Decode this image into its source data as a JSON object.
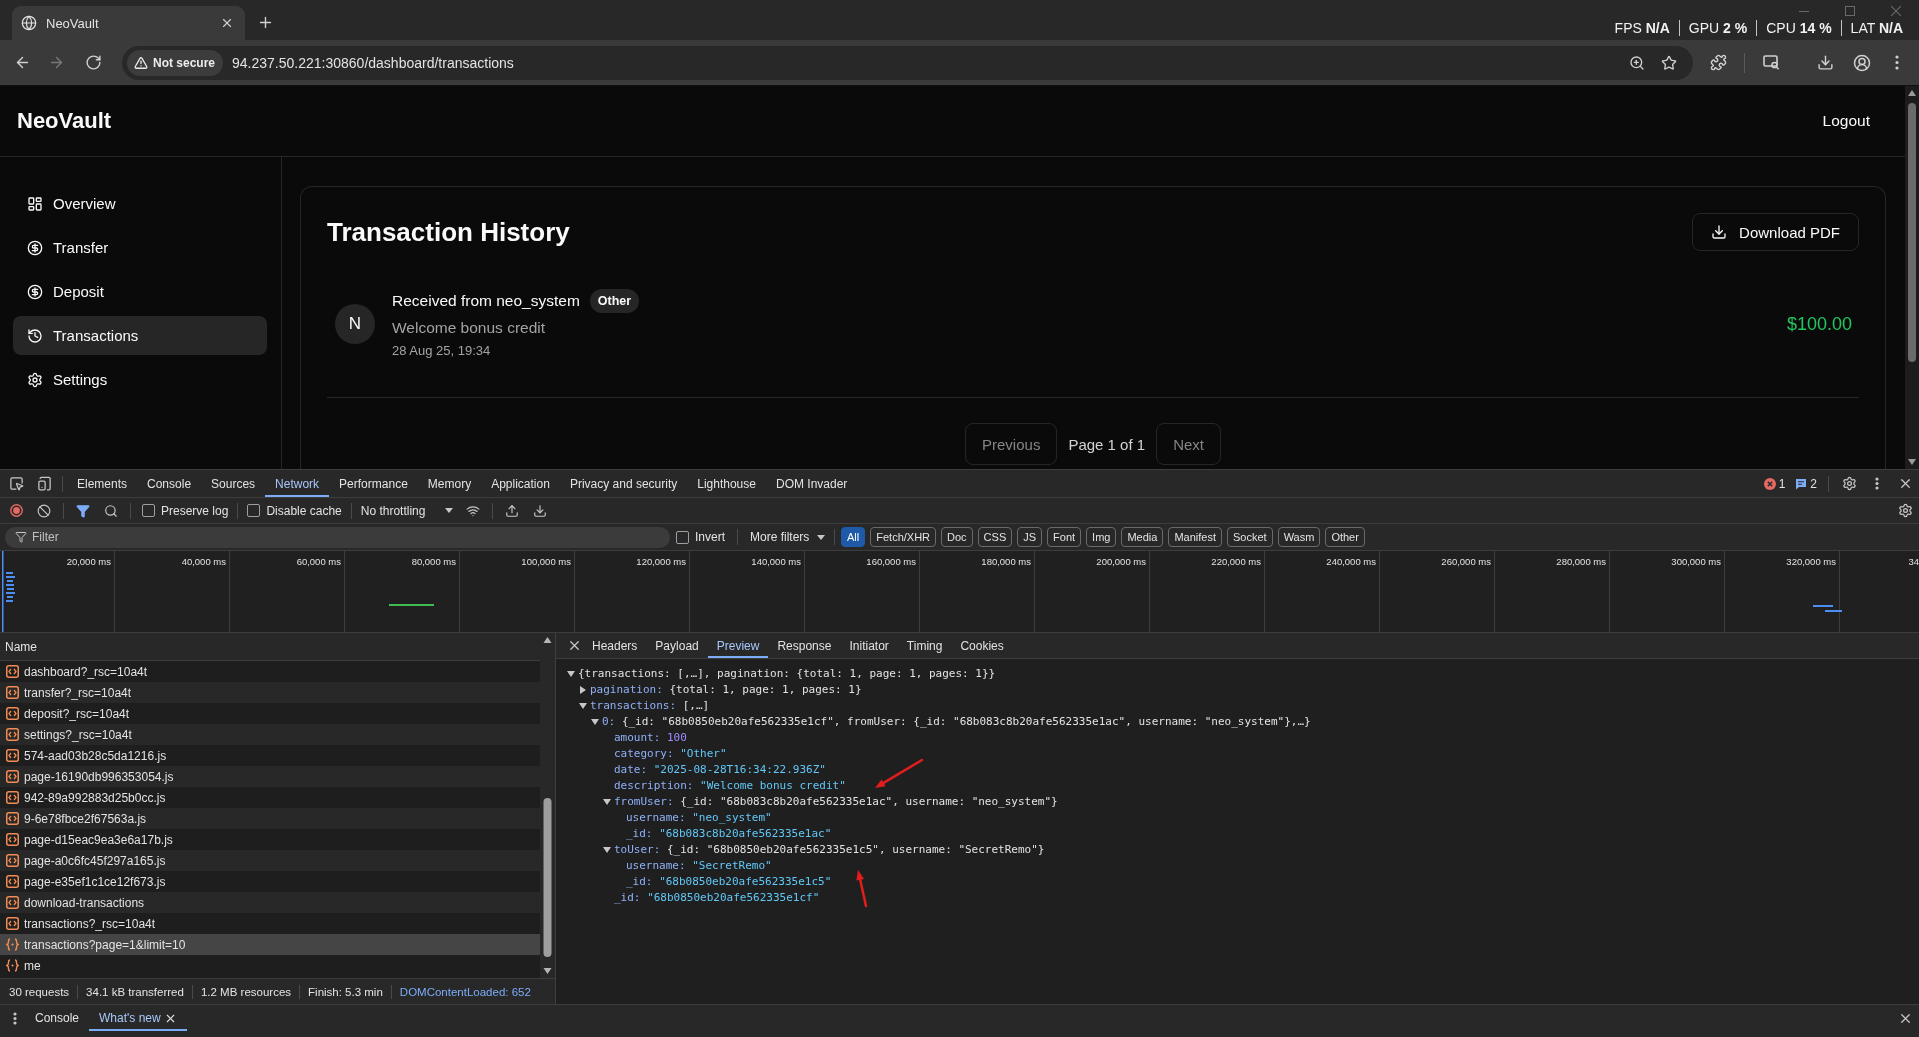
{
  "browser": {
    "tab": {
      "title": "NeoVault"
    },
    "perf_overlay": [
      {
        "label": "FPS",
        "value": "N/A"
      },
      {
        "label": "GPU",
        "value": "2 %"
      },
      {
        "label": "CPU",
        "value": "14 %"
      },
      {
        "label": "LAT",
        "value": "N/A"
      }
    ],
    "nav_buttons": [
      {
        "kind": "back",
        "disabled": false
      },
      {
        "kind": "forward",
        "disabled": true
      },
      {
        "kind": "reload",
        "disabled": false
      }
    ],
    "security_chip": "Not secure",
    "url": "94.237.50.221:30860/dashboard/transactions"
  },
  "app": {
    "brand": "NeoVault",
    "logout": "Logout",
    "nav": [
      {
        "label": "Overview",
        "kind": "grid",
        "selected": false
      },
      {
        "label": "Transfer",
        "kind": "dollar",
        "selected": false
      },
      {
        "label": "Deposit",
        "kind": "dollar",
        "selected": false
      },
      {
        "label": "Transactions",
        "kind": "history",
        "selected": true
      },
      {
        "label": "Settings",
        "kind": "gear",
        "selected": false
      }
    ],
    "title": "Transaction History",
    "download_button": "Download PDF",
    "transactions": [
      {
        "avatar": "N",
        "title": "Received from neo_system",
        "category": "Other",
        "description": "Welcome bonus credit",
        "date": "28 Aug 25, 19:34",
        "amount": "$100.00",
        "incoming": true
      }
    ],
    "pagination": {
      "previous": {
        "label": "Previous",
        "disabled": true
      },
      "status": "Page 1 of 1",
      "next": {
        "label": "Next",
        "disabled": true
      }
    }
  },
  "devtools": {
    "panel_tabs": [
      {
        "label": "Elements",
        "selected": false
      },
      {
        "label": "Console",
        "selected": false
      },
      {
        "label": "Sources",
        "selected": false
      },
      {
        "label": "Network",
        "selected": true
      },
      {
        "label": "Performance",
        "selected": false
      },
      {
        "label": "Memory",
        "selected": false
      },
      {
        "label": "Application",
        "selected": false
      },
      {
        "label": "Privacy and security",
        "selected": false
      },
      {
        "label": "Lighthouse",
        "selected": false
      },
      {
        "label": "DOM Invader",
        "selected": false
      }
    ],
    "issue_counts": [
      {
        "kind": "error",
        "count": "1"
      },
      {
        "kind": "message",
        "count": "2"
      }
    ],
    "network_toolbar": {
      "recording": true,
      "filter_active": true,
      "options": [
        {
          "label": "Preserve log",
          "checked": false
        },
        {
          "label": "Disable cache",
          "checked": false
        }
      ],
      "throttling": "No throttling"
    },
    "filter_bar": {
      "placeholder": "Filter",
      "invert": {
        "label": "Invert",
        "checked": false
      },
      "more_filters": "More filters",
      "types": [
        {
          "label": "All",
          "selected": true
        },
        {
          "label": "Fetch/XHR",
          "selected": false
        },
        {
          "label": "Doc",
          "selected": false
        },
        {
          "label": "CSS",
          "selected": false
        },
        {
          "label": "JS",
          "selected": false
        },
        {
          "label": "Font",
          "selected": false
        },
        {
          "label": "Img",
          "selected": false
        },
        {
          "label": "Media",
          "selected": false
        },
        {
          "label": "Manifest",
          "selected": false
        },
        {
          "label": "Socket",
          "selected": false
        },
        {
          "label": "Wasm",
          "selected": false
        },
        {
          "label": "Other",
          "selected": false
        }
      ]
    },
    "timeline": {
      "ticks": [
        "20,000 ms",
        "40,000 ms",
        "60,000 ms",
        "80,000 ms",
        "100,000 ms",
        "120,000 ms",
        "140,000 ms",
        "160,000 ms",
        "180,000 ms",
        "200,000 ms",
        "220,000 ms",
        "240,000 ms",
        "260,000 ms",
        "280,000 ms",
        "300,000 ms",
        "320,000 ms",
        "34"
      ]
    },
    "requests": {
      "column": "Name",
      "rows": [
        {
          "name": "dashboard?_rsc=10a4t",
          "kind": "code",
          "selected": false
        },
        {
          "name": "transfer?_rsc=10a4t",
          "kind": "code",
          "selected": false
        },
        {
          "name": "deposit?_rsc=10a4t",
          "kind": "code",
          "selected": false
        },
        {
          "name": "settings?_rsc=10a4t",
          "kind": "code",
          "selected": false
        },
        {
          "name": "574-aad03b28c5da1216.js",
          "kind": "code",
          "selected": false
        },
        {
          "name": "page-16190db996353054.js",
          "kind": "code",
          "selected": false
        },
        {
          "name": "942-89a992883d25b0cc.js",
          "kind": "code",
          "selected": false
        },
        {
          "name": "9-6e78fbce2f67563a.js",
          "kind": "code",
          "selected": false
        },
        {
          "name": "page-d15eac9ea3e6a17b.js",
          "kind": "code",
          "selected": false
        },
        {
          "name": "page-a0c6fc45f297a165.js",
          "kind": "code",
          "selected": false
        },
        {
          "name": "page-e35ef1c1ce12f673.js",
          "kind": "code",
          "selected": false
        },
        {
          "name": "download-transactions",
          "kind": "code",
          "selected": false
        },
        {
          "name": "transactions?_rsc=10a4t",
          "kind": "code",
          "selected": false
        },
        {
          "name": "transactions?page=1&limit=10",
          "kind": "fetch",
          "selected": true
        },
        {
          "name": "me",
          "kind": "fetch",
          "selected": false
        }
      ]
    },
    "summary": [
      {
        "text": "30 requests",
        "kind": "count"
      },
      {
        "text": "34.1 kB transferred",
        "kind": "count"
      },
      {
        "text": "1.2 MB resources",
        "kind": "count"
      },
      {
        "text": "Finish: 5.3 min",
        "kind": "count"
      },
      {
        "text": "DOMContentLoaded: 652",
        "kind": "dom_content_loaded"
      }
    ],
    "detail_tabs": [
      {
        "label": "Headers",
        "selected": false
      },
      {
        "label": "Payload",
        "selected": false
      },
      {
        "label": "Preview",
        "selected": true
      },
      {
        "label": "Response",
        "selected": false
      },
      {
        "label": "Initiator",
        "selected": false
      },
      {
        "label": "Timing",
        "selected": false
      },
      {
        "label": "Cookies",
        "selected": false
      }
    ],
    "preview": {
      "value": "{transactions: [,…], pagination: {total: 1, page: 1, pages: 1}}",
      "kind": "object",
      "expanded": true,
      "children": [
        {
          "key": "pagination:",
          "value": "{total: 1, page: 1, pages: 1}",
          "kind": "object",
          "expanded": false
        },
        {
          "key": "transactions:",
          "value": "[,…]",
          "kind": "object",
          "expanded": true,
          "children": [
            {
              "key": "0:",
              "value": "{_id: \"68b0850eb20afe562335e1cf\", fromUser: {_id: \"68b083c8b20afe562335e1ac\", username: \"neo_system\"},…}",
              "kind": "object",
              "expanded": true,
              "children": [
                {
                  "key": "amount:",
                  "value": "100",
                  "kind": "number"
                },
                {
                  "key": "category:",
                  "value": "\"Other\"",
                  "kind": "string"
                },
                {
                  "key": "date:",
                  "value": "\"2025-08-28T16:34:22.936Z\"",
                  "kind": "string"
                },
                {
                  "key": "description:",
                  "value": "\"Welcome bonus credit\"",
                  "kind": "string"
                },
                {
                  "key": "fromUser:",
                  "value": "{_id: \"68b083c8b20afe562335e1ac\", username: \"neo_system\"}",
                  "kind": "object",
                  "expanded": true,
                  "children": [
                    {
                      "key": "username:",
                      "value": "\"neo_system\"",
                      "kind": "string"
                    },
                    {
                      "key": "_id:",
                      "value": "\"68b083c8b20afe562335e1ac\"",
                      "kind": "string"
                    }
                  ]
                },
                {
                  "key": "toUser:",
                  "value": "{_id: \"68b0850eb20afe562335e1c5\", username: \"SecretRemo\"}",
                  "kind": "object",
                  "expanded": true,
                  "children": [
                    {
                      "key": "username:",
                      "value": "\"SecretRemo\"",
                      "kind": "string"
                    },
                    {
                      "key": "_id:",
                      "value": "\"68b0850eb20afe562335e1c5\"",
                      "kind": "string"
                    }
                  ]
                },
                {
                  "key": "_id:",
                  "value": "\"68b0850eb20afe562335e1cf\"",
                  "kind": "string"
                }
              ]
            }
          ]
        }
      ]
    },
    "drawer_tabs": [
      {
        "label": "Console",
        "selected": false,
        "closable": false
      },
      {
        "label": "What's new",
        "selected": true,
        "closable": true
      }
    ]
  }
}
